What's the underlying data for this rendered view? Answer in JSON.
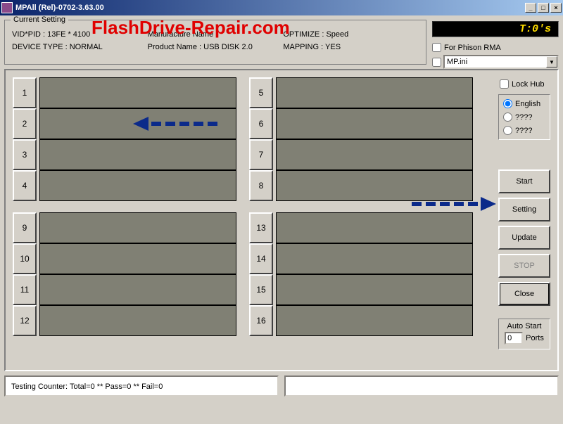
{
  "window": {
    "title": "MPAll (Rel)-0702-3.63.00"
  },
  "brand": "FlashDrive-Repair.com",
  "lcd": "T:0's",
  "settings": {
    "legend": "Current Setting",
    "vidpid_label": "VID*PID : 13FE * 4100",
    "manuf_label": "Manufacture Name :",
    "optimize_label": "OPTIMIZE : Speed",
    "devtype_label": "DEVICE TYPE : NORMAL",
    "product_label": "Product Name : USB DISK 2.0",
    "mapping_label": "MAPPING : YES"
  },
  "rma": {
    "label": "For Phison RMA",
    "checked": false
  },
  "inifile": {
    "value": "MP.ini"
  },
  "lockhub": {
    "label": "Lock Hub",
    "checked": false
  },
  "lang": {
    "opt1": "English",
    "opt2": "????",
    "opt3": "????"
  },
  "buttons": {
    "start": "Start",
    "setting": "Setting",
    "update": "Update",
    "stop": "STOP",
    "close": "Close"
  },
  "autostart": {
    "label": "Auto Start",
    "value": "0",
    "unit": "Ports"
  },
  "slots_left_a": [
    "1",
    "2",
    "3",
    "4"
  ],
  "slots_right_a": [
    "5",
    "6",
    "7",
    "8"
  ],
  "slots_left_b": [
    "9",
    "10",
    "11",
    "12"
  ],
  "slots_right_b": [
    "13",
    "14",
    "15",
    "16"
  ],
  "status": {
    "text": "Testing Counter: Total=0 ** Pass=0 ** Fail=0"
  }
}
